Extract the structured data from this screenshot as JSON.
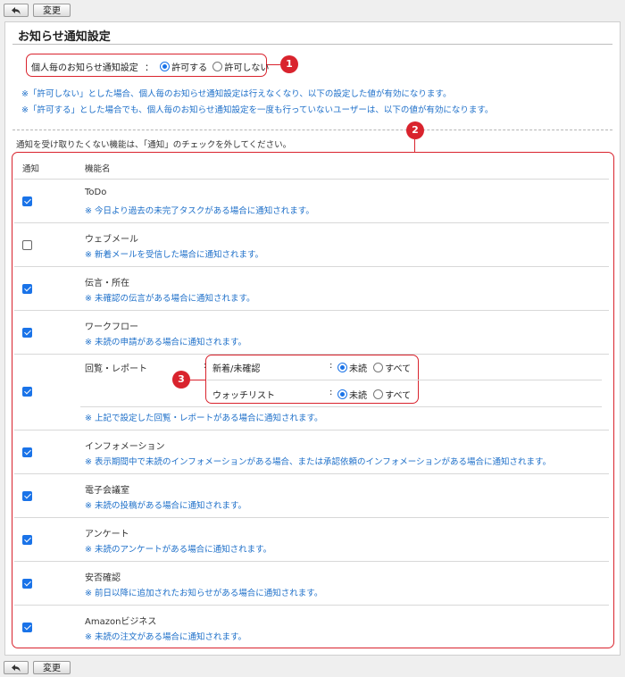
{
  "toolbar": {
    "back_icon": "back-arrow-icon",
    "change_label": "変更"
  },
  "page": {
    "title": "お知らせ通知設定"
  },
  "personal_setting": {
    "label": "個人毎のお知らせ通知設定",
    "colon": "：",
    "options": [
      {
        "label": "許可する",
        "selected": true
      },
      {
        "label": "許可しない",
        "selected": false
      }
    ]
  },
  "notes": [
    "※「許可しない」とした場合、個人毎のお知らせ通知設定は行えなくなり、以下の設定した値が有効になります。",
    "※「許可する」とした場合でも、個人毎のお知らせ通知設定を一度も行っていないユーザーは、以下の値が有効になります。"
  ],
  "instruction": "通知を受け取りたくない機能は、「通知」のチェックを外してください。",
  "table": {
    "headers": {
      "notify": "通知",
      "feature": "機能名"
    },
    "rows": [
      {
        "checked": true,
        "name": "ToDo",
        "desc": "※ 今日より過去の未完了タスクがある場合に通知されます。"
      },
      {
        "checked": false,
        "name": "ウェブメール",
        "desc": "※ 新着メールを受信した場合に通知されます。"
      },
      {
        "checked": true,
        "name": "伝言・所在",
        "desc": "※ 未確認の伝言がある場合に通知されます。"
      },
      {
        "checked": true,
        "name": "ワークフロー",
        "desc": "※ 未読の申請がある場合に通知されます。"
      },
      {
        "checked": true,
        "name": "回覧・レポート",
        "desc": "※ 上記で設定した回覧・レポートがある場合に通知されます。"
      },
      {
        "checked": true,
        "name": "インフォメーション",
        "desc": "※ 表示期間中で未読のインフォメーションがある場合、または承認依頼のインフォメーションがある場合に通知されます。"
      },
      {
        "checked": true,
        "name": "電子会議室",
        "desc": "※ 未読の投稿がある場合に通知されます。"
      },
      {
        "checked": true,
        "name": "アンケート",
        "desc": "※ 未読のアンケートがある場合に通知されます。"
      },
      {
        "checked": true,
        "name": "安否確認",
        "desc": "※ 前日以降に追加されたお知らせがある場合に通知されます。"
      },
      {
        "checked": true,
        "name": "Amazonビジネス",
        "desc": "※ 未読の注文がある場合に通知されます。"
      }
    ],
    "circulation_options": {
      "colon": ":",
      "items": [
        {
          "label": "新着/未確認",
          "options": [
            {
              "label": "未読",
              "selected": true
            },
            {
              "label": "すべて",
              "selected": false
            }
          ]
        },
        {
          "label": "ウォッチリスト",
          "options": [
            {
              "label": "未読",
              "selected": true
            },
            {
              "label": "すべて",
              "selected": false
            }
          ]
        }
      ]
    }
  },
  "callouts": [
    "1",
    "2",
    "3"
  ],
  "colors": {
    "accent": "#1a73e8",
    "note": "#1d6fc9",
    "callout": "#d9232d"
  }
}
